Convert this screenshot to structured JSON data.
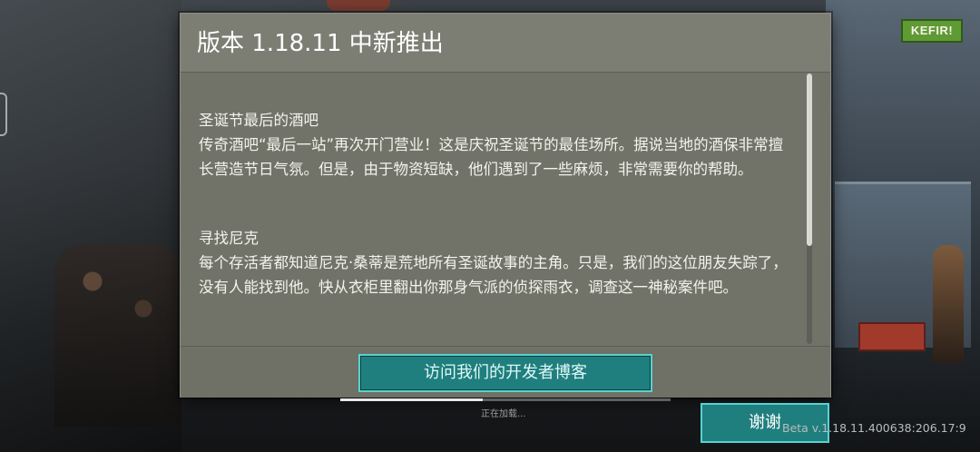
{
  "brand": {
    "logo_text": "KEFIR!",
    "logo_color": "#5f9a34"
  },
  "dialog": {
    "title": "版本 1.18.11 中新推出",
    "sections": [
      {
        "title": "圣诞节最后的酒吧",
        "body": "传奇酒吧“最后一站”再次开门营业！这是庆祝圣诞节的最佳场所。据说当地的酒保非常擅长营造节日气氛。但是，由于物资短缺，他们遇到了一些麻烦，非常需要你的帮助。"
      },
      {
        "title": "寻找尼克",
        "body": "每个存活者都知道尼克·桑蒂是荒地所有圣诞故事的主角。只是，我们的这位朋友失踪了，没有人能找到他。快从衣柜里翻出你那身气派的侦探雨衣，调查这一神秘案件吧。"
      }
    ],
    "blog_button_label": "访问我们的开发者博客",
    "scroll_position_fraction": 0.0
  },
  "loading": {
    "text": "正在加载...",
    "progress_fraction": 0.43
  },
  "thanks_button_label": "谢谢",
  "version_text": "Beta v.1.18.11.400638:206.17:9",
  "colors": {
    "dialog_bg": "#727368",
    "button_bg": "#1f7f7e",
    "button_border": "#57d3d0"
  }
}
